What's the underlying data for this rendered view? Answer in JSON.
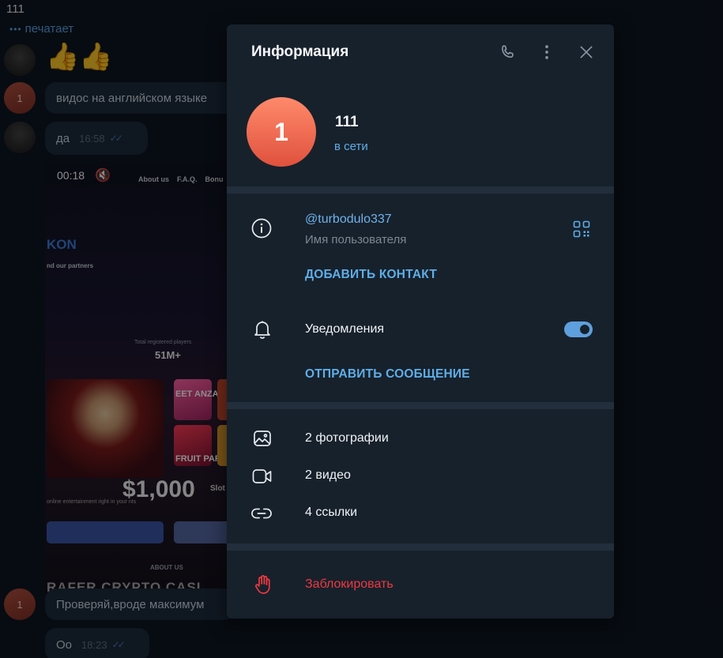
{
  "chat": {
    "title": "111",
    "typing": "печатает",
    "avatar_letter": "1",
    "messages": [
      {
        "text": "видос на английском языке"
      },
      {
        "text": "да",
        "time": "16:58"
      },
      {
        "text": "Проверяй,вроде максимум"
      },
      {
        "text": "Oo",
        "time": "18:23"
      }
    ],
    "media": {
      "timer": "00:18",
      "nav": [
        "About us",
        "F.A.Q.",
        "Bonu"
      ],
      "brand": "KON",
      "partners": "nd our partners",
      "registered_label": "Total registered players",
      "registered_value": "51M+",
      "tile1": "EET ANZA",
      "tile2": "FRUIT PARTY",
      "prize": "$1,000",
      "slots": "Slot",
      "promo": "online entertainment right in your nts",
      "about": "ABOUT US",
      "stripe": "RAFER CRYPTO CASI"
    }
  },
  "panel": {
    "title": "Информация",
    "icons": {
      "call": "phone-icon",
      "more": "more-vertical-icon",
      "close": "close-icon"
    },
    "profile": {
      "avatar_letter": "1",
      "name": "111",
      "status": "в сети"
    },
    "info": {
      "username": "@turbodulo337",
      "username_label": "Имя пользователя",
      "add_contact": "ДОБАВИТЬ КОНТАКТ",
      "notifications": "Уведомления",
      "notifications_on": true,
      "send_message": "ОТПРАВИТЬ СООБЩЕНИЕ"
    },
    "media": {
      "photos": "2 фотографии",
      "videos": "2 видео",
      "links": "4 ссылки"
    },
    "block": "Заблокировать",
    "colors": {
      "accent": "#5eaee8",
      "danger": "#ec3942",
      "panel_bg": "#17212b"
    }
  }
}
